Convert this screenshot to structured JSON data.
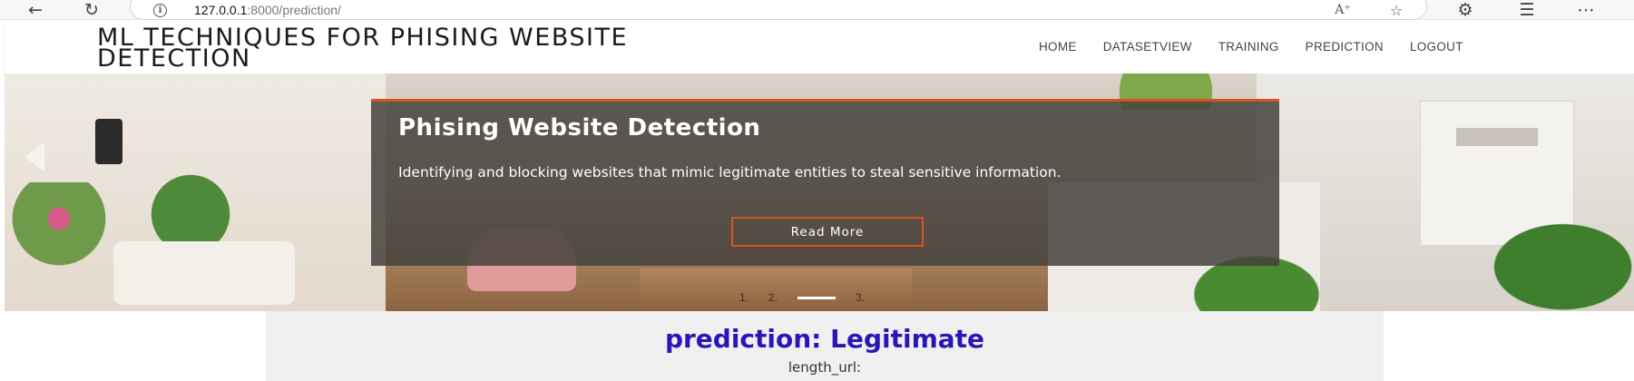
{
  "browser": {
    "url_host": "127.0.0.1",
    "url_rest": ":8000/prediction/",
    "icons": [
      "back-arrow-icon",
      "refresh-icon",
      "info-icon",
      "read-aloud-icon",
      "favorite-star-icon",
      "extensions-icon",
      "favorites-icon",
      "more-icon"
    ]
  },
  "header": {
    "brand_line1": "ML TECHNIQUES FOR PHISING WEBSITE",
    "brand_line2": "DETECTION",
    "menu": [
      "HOME",
      "DATASETVIEW",
      "TRAINING",
      "PREDICTION",
      "LOGOUT"
    ]
  },
  "hero": {
    "title": "Phising Website Detection",
    "description": "Identifying and blocking websites that mimic legitimate entities to steal sensitive information.",
    "button_label": "Read More",
    "indicators": [
      "1.",
      "2.",
      "3."
    ],
    "colors": {
      "accent": "#d9531e",
      "caption_bg": "#46423e"
    }
  },
  "result": {
    "heading": "prediction: Legitimate",
    "field_label": "length_url:",
    "heading_color": "#2a16b8"
  }
}
